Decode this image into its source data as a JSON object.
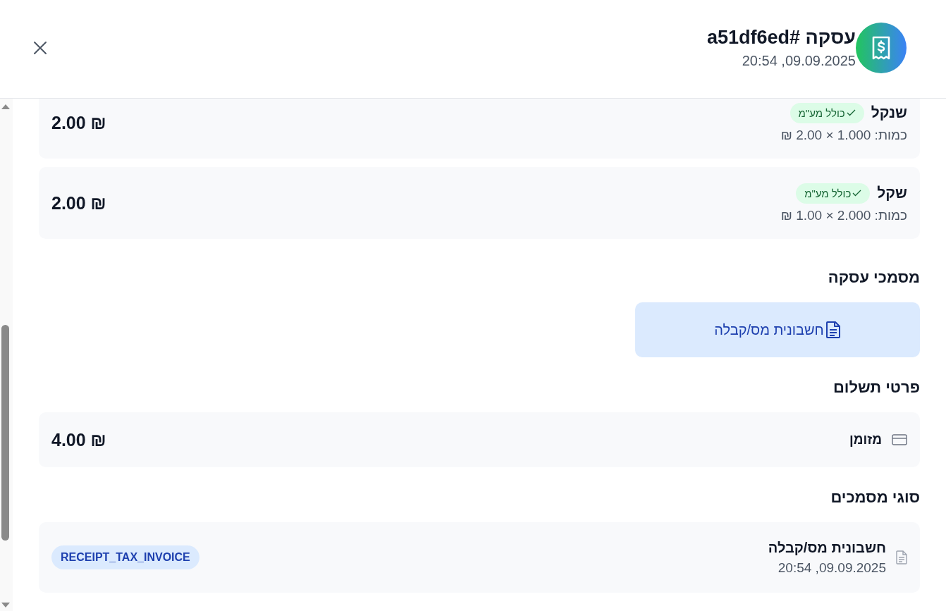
{
  "header": {
    "title": "עסקה #a51df6ed",
    "date": "09.09.2025, 20:54"
  },
  "items": [
    {
      "name": "שנקל",
      "badge": "כולל מע\"מ",
      "quantity": "כמות: 1.000 × 2.00 ₪",
      "total": "2.00 ₪"
    },
    {
      "name": "שקל",
      "badge": "כולל מע\"מ",
      "quantity": "כמות: 2.000 × 1.00 ₪",
      "total": "2.00 ₪"
    }
  ],
  "documents": {
    "title": "מסמכי עסקה",
    "button": "חשבונית מס/קבלה"
  },
  "payment": {
    "title": "פרטי תשלום",
    "method": "מזומן",
    "amount": "4.00 ₪"
  },
  "document_types": {
    "title": "סוגי מסמכים",
    "rows": [
      {
        "name": "חשבונית מס/קבלה",
        "date": "09.09.2025, 20:54",
        "tag": "RECEIPT_TAX_INVOICE"
      }
    ]
  }
}
